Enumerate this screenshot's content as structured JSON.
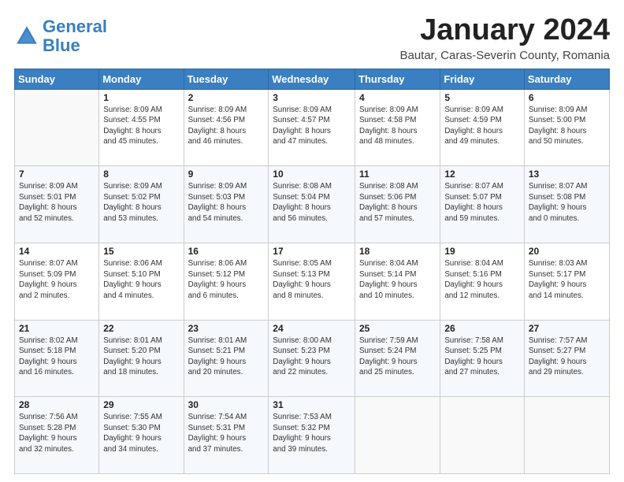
{
  "header": {
    "logo_line1": "General",
    "logo_line2": "Blue",
    "month_title": "January 2024",
    "subtitle": "Bautar, Caras-Severin County, Romania"
  },
  "weekdays": [
    "Sunday",
    "Monday",
    "Tuesday",
    "Wednesday",
    "Thursday",
    "Friday",
    "Saturday"
  ],
  "weeks": [
    [
      {
        "day": "",
        "info": ""
      },
      {
        "day": "1",
        "info": "Sunrise: 8:09 AM\nSunset: 4:55 PM\nDaylight: 8 hours\nand 45 minutes."
      },
      {
        "day": "2",
        "info": "Sunrise: 8:09 AM\nSunset: 4:56 PM\nDaylight: 8 hours\nand 46 minutes."
      },
      {
        "day": "3",
        "info": "Sunrise: 8:09 AM\nSunset: 4:57 PM\nDaylight: 8 hours\nand 47 minutes."
      },
      {
        "day": "4",
        "info": "Sunrise: 8:09 AM\nSunset: 4:58 PM\nDaylight: 8 hours\nand 48 minutes."
      },
      {
        "day": "5",
        "info": "Sunrise: 8:09 AM\nSunset: 4:59 PM\nDaylight: 8 hours\nand 49 minutes."
      },
      {
        "day": "6",
        "info": "Sunrise: 8:09 AM\nSunset: 5:00 PM\nDaylight: 8 hours\nand 50 minutes."
      }
    ],
    [
      {
        "day": "7",
        "info": "Sunrise: 8:09 AM\nSunset: 5:01 PM\nDaylight: 8 hours\nand 52 minutes."
      },
      {
        "day": "8",
        "info": "Sunrise: 8:09 AM\nSunset: 5:02 PM\nDaylight: 8 hours\nand 53 minutes."
      },
      {
        "day": "9",
        "info": "Sunrise: 8:09 AM\nSunset: 5:03 PM\nDaylight: 8 hours\nand 54 minutes."
      },
      {
        "day": "10",
        "info": "Sunrise: 8:08 AM\nSunset: 5:04 PM\nDaylight: 8 hours\nand 56 minutes."
      },
      {
        "day": "11",
        "info": "Sunrise: 8:08 AM\nSunset: 5:06 PM\nDaylight: 8 hours\nand 57 minutes."
      },
      {
        "day": "12",
        "info": "Sunrise: 8:07 AM\nSunset: 5:07 PM\nDaylight: 8 hours\nand 59 minutes."
      },
      {
        "day": "13",
        "info": "Sunrise: 8:07 AM\nSunset: 5:08 PM\nDaylight: 9 hours\nand 0 minutes."
      }
    ],
    [
      {
        "day": "14",
        "info": "Sunrise: 8:07 AM\nSunset: 5:09 PM\nDaylight: 9 hours\nand 2 minutes."
      },
      {
        "day": "15",
        "info": "Sunrise: 8:06 AM\nSunset: 5:10 PM\nDaylight: 9 hours\nand 4 minutes."
      },
      {
        "day": "16",
        "info": "Sunrise: 8:06 AM\nSunset: 5:12 PM\nDaylight: 9 hours\nand 6 minutes."
      },
      {
        "day": "17",
        "info": "Sunrise: 8:05 AM\nSunset: 5:13 PM\nDaylight: 9 hours\nand 8 minutes."
      },
      {
        "day": "18",
        "info": "Sunrise: 8:04 AM\nSunset: 5:14 PM\nDaylight: 9 hours\nand 10 minutes."
      },
      {
        "day": "19",
        "info": "Sunrise: 8:04 AM\nSunset: 5:16 PM\nDaylight: 9 hours\nand 12 minutes."
      },
      {
        "day": "20",
        "info": "Sunrise: 8:03 AM\nSunset: 5:17 PM\nDaylight: 9 hours\nand 14 minutes."
      }
    ],
    [
      {
        "day": "21",
        "info": "Sunrise: 8:02 AM\nSunset: 5:18 PM\nDaylight: 9 hours\nand 16 minutes."
      },
      {
        "day": "22",
        "info": "Sunrise: 8:01 AM\nSunset: 5:20 PM\nDaylight: 9 hours\nand 18 minutes."
      },
      {
        "day": "23",
        "info": "Sunrise: 8:01 AM\nSunset: 5:21 PM\nDaylight: 9 hours\nand 20 minutes."
      },
      {
        "day": "24",
        "info": "Sunrise: 8:00 AM\nSunset: 5:23 PM\nDaylight: 9 hours\nand 22 minutes."
      },
      {
        "day": "25",
        "info": "Sunrise: 7:59 AM\nSunset: 5:24 PM\nDaylight: 9 hours\nand 25 minutes."
      },
      {
        "day": "26",
        "info": "Sunrise: 7:58 AM\nSunset: 5:25 PM\nDaylight: 9 hours\nand 27 minutes."
      },
      {
        "day": "27",
        "info": "Sunrise: 7:57 AM\nSunset: 5:27 PM\nDaylight: 9 hours\nand 29 minutes."
      }
    ],
    [
      {
        "day": "28",
        "info": "Sunrise: 7:56 AM\nSunset: 5:28 PM\nDaylight: 9 hours\nand 32 minutes."
      },
      {
        "day": "29",
        "info": "Sunrise: 7:55 AM\nSunset: 5:30 PM\nDaylight: 9 hours\nand 34 minutes."
      },
      {
        "day": "30",
        "info": "Sunrise: 7:54 AM\nSunset: 5:31 PM\nDaylight: 9 hours\nand 37 minutes."
      },
      {
        "day": "31",
        "info": "Sunrise: 7:53 AM\nSunset: 5:32 PM\nDaylight: 9 hours\nand 39 minutes."
      },
      {
        "day": "",
        "info": ""
      },
      {
        "day": "",
        "info": ""
      },
      {
        "day": "",
        "info": ""
      }
    ]
  ]
}
